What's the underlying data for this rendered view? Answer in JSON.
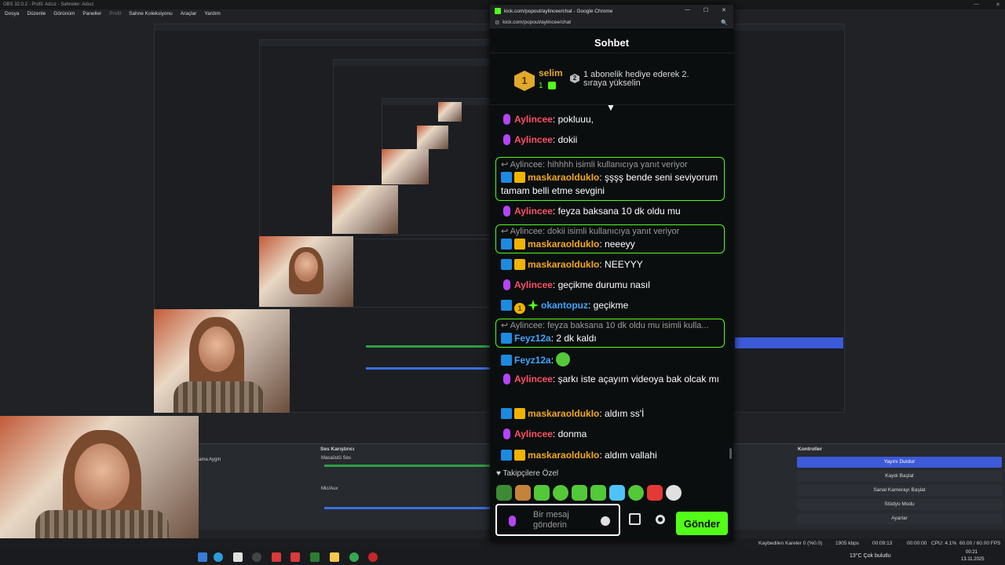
{
  "obs": {
    "title": "OBS 32.0.2 - Profil: Adsız - Sahneler: Adsız",
    "menu": [
      "Dosya",
      "Düzenle",
      "Görünüm",
      "Paneller",
      "Profil",
      "Sahne Koleksiyonu",
      "Araçlar",
      "Yardım"
    ],
    "docks": {
      "audio_mixer_title": "Ses Karıştırıcı",
      "audio_source_1": "Masaüstü Ses",
      "audio_source_2": "Mic/Aux",
      "audio_device_label": "ama Aygıtı",
      "controls_title": "Kontroller",
      "controls": [
        "Yayını Durdur",
        "Kaydı Başlat",
        "Sanal Kamerayı Başlat",
        "Stüdyo Modu",
        "Ayarlar"
      ]
    },
    "status": {
      "dropped_frames": "Kaybedilen Kareler 0 (%0.0)",
      "bitrate": "1905 kbps",
      "stream_time": "00:09:13",
      "record_time": "00:00:00",
      "cpu": "CPU: 4.1%",
      "fps": "60.00 / 60.00 FPS"
    },
    "taskbar": {
      "weather": "13°C  Çok bulutlu",
      "time": "00:21",
      "date": "13.11.2025"
    }
  },
  "chrome": {
    "window_title": "kick.com/popout/aylincee/chat - Google Chrome",
    "url": "kick.com/popout/aylincee/chat"
  },
  "chat": {
    "header": "Sohbet",
    "pinned": {
      "rank_number": "1",
      "user": "selim",
      "gift_count": "1",
      "next_rank": "2",
      "text": "1 abonelik hediye ederek 2. sıraya yükselin"
    },
    "messages": [
      {
        "user": "Aylincee",
        "text": ": pokluuu,"
      },
      {
        "user": "Aylincee",
        "text": ": dokii"
      },
      {
        "reply_to": "Aylincee: hihhhh isimli kullanıcıya yanıt veriyor",
        "user": "maskaraoldukIo",
        "text": ": şşşş bende seni seviyorum tamam belli etme sevgini"
      },
      {
        "user": "Aylincee",
        "text": ": feyza baksana 10 dk oldu mu"
      },
      {
        "reply_to": "Aylincee: dokii isimli kullanıcıya yanıt veriyor",
        "user": "maskaraoldukIo",
        "text": ": neeeyy"
      },
      {
        "user": "maskaraoldukIo",
        "text": ": NEEYYY"
      },
      {
        "user": "Aylincee",
        "text": ": geçikme durumu nasıl"
      },
      {
        "user": "okantopuz",
        "sub_months": "1",
        "text": ": geçikme"
      },
      {
        "reply_to": "Aylincee: feyza baksana 10 dk oldu mu isimli kulla...",
        "user": "Feyz12a",
        "text": ": 2 dk kaldı"
      },
      {
        "user": "Feyz12a",
        "text": ":"
      },
      {
        "user": "Aylincee",
        "text": ": şarkı iste açayım videoya bak olcak mı"
      },
      {
        "user": "maskaraoldukIo",
        "text": ": aldım ss'İ"
      },
      {
        "user": "Aylincee",
        "text": ": donma"
      },
      {
        "user": "maskaraoldukIo",
        "text": ": aldım vallahi"
      }
    ],
    "followers_label": "Takipçilere Özel",
    "input_placeholder": "Bir mesaj gönderin",
    "send_label": "Gönder"
  },
  "colors": {
    "kick_green": "#53fc18",
    "name_red": "#ff4f64",
    "name_gold": "#f3a81b",
    "name_blue": "#3ea6ff",
    "obs_active": "#3d5ad9"
  }
}
